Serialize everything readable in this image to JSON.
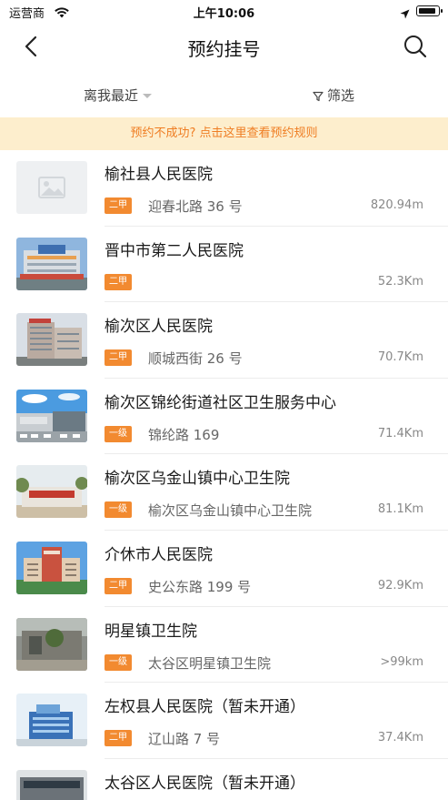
{
  "status_bar": {
    "carrier": "运营商",
    "time": "上午10:06"
  },
  "nav": {
    "title": "预约挂号",
    "back_icon": "chevron-left-icon",
    "search_icon": "search-icon"
  },
  "filters": {
    "sort_label": "离我最近",
    "filter_label": "筛选"
  },
  "notice": {
    "text": "预约不成功? 点击这里查看预约规则"
  },
  "colors": {
    "accent": "#f28a30",
    "notice_bg": "#fdeecd",
    "notice_text": "#ef7d22"
  },
  "hospitals": [
    {
      "name": "榆社县人民医院",
      "level": "二甲",
      "address": "迎春北路 36 号",
      "distance": "820.94m"
    },
    {
      "name": "晋中市第二人民医院",
      "level": "二甲",
      "address": "",
      "distance": "52.3Km"
    },
    {
      "name": "榆次区人民医院",
      "level": "二甲",
      "address": "顺城西街 26 号",
      "distance": "70.7Km"
    },
    {
      "name": "榆次区锦纶街道社区卫生服务中心",
      "level": "一级",
      "address": "锦纶路 169",
      "distance": "71.4Km"
    },
    {
      "name": "榆次区乌金山镇中心卫生院",
      "level": "一级",
      "address": "榆次区乌金山镇中心卫生院",
      "distance": "81.1Km"
    },
    {
      "name": "介休市人民医院",
      "level": "二甲",
      "address": "史公东路 199 号",
      "distance": "92.9Km"
    },
    {
      "name": "明星镇卫生院",
      "level": "一级",
      "address": "太谷区明星镇卫生院",
      "distance": ">99km"
    },
    {
      "name": "左权县人民医院（暂未开通）",
      "level": "二甲",
      "address": "辽山路 7 号",
      "distance": "37.4Km"
    },
    {
      "name": "太谷区人民医院（暂未开通）",
      "level": "",
      "address": "",
      "distance": ""
    }
  ]
}
